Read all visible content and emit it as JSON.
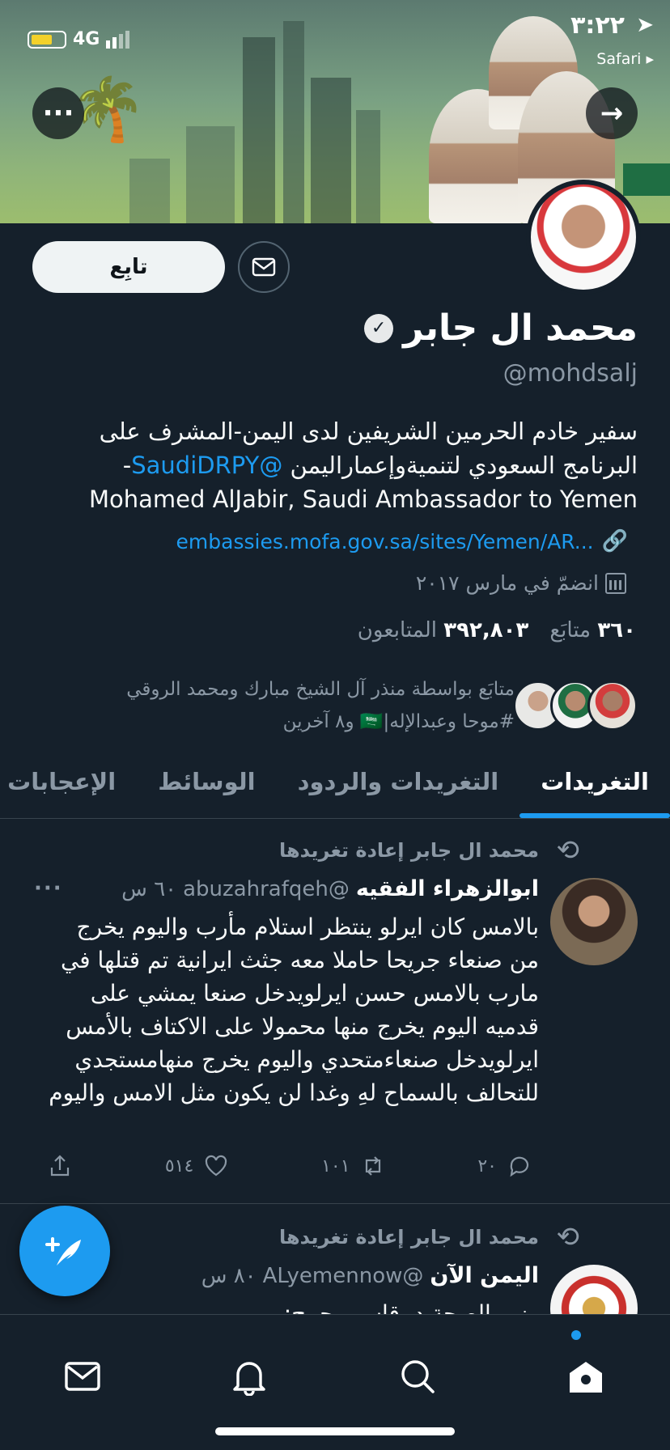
{
  "status_bar": {
    "time": "٣:٢٢",
    "back_app": "Safari ▸",
    "network": "4G"
  },
  "profile": {
    "name": "محمد ال جابر",
    "handle": "@mohdsalj",
    "follow_label": "تابِع",
    "bio_line1": "سفير خادم الحرمين الشريفين لدى اليمن-المشرف على",
    "bio_line2_prefix": "البرنامج السعودي لتنميةوإعماراليمن ",
    "bio_mention": "@SaudiDRPY",
    "bio_line2_suffix": "-",
    "bio_line3": "Mohamed AlJabir, Saudi Ambassador to Yemen",
    "website": "embassies.mofa.gov.sa/sites/Yemen/AR...",
    "joined": "انضمّ في مارس ٢٠١٧",
    "following_count": "٣٦٠",
    "following_label": "متابَع",
    "followers_count": "٣٩٢,٨٠٣",
    "followers_label": "المتابعون",
    "followed_by_line1": "متابَع بواسطة منذر آل الشيخ مبارك ومحمد الروقي",
    "followed_by_line2": "#موحا وعبدالإله|🇸🇦 و٨ آخرين"
  },
  "tabs": [
    {
      "label": "التغريدات",
      "active": true
    },
    {
      "label": "التغريدات والردود",
      "active": false
    },
    {
      "label": "الوسائط",
      "active": false
    },
    {
      "label": "الإعجابات",
      "active": false
    }
  ],
  "tweets": [
    {
      "retweet_label": "محمد ال جابر إعادة تغريدها",
      "author": "ابوالزهراء الفقيه",
      "handle": "@abuzahrafqeh",
      "time": "٦٠ س",
      "more": "···",
      "body": "بالامس كان ايرلو ينتظر استلام مأرب واليوم يخرج من صنعاء جريحا حاملا معه جثث ايرانية  تم قتلها في مارب بالامس حسن ايرلويدخل صنعا يمشي على قدميه اليوم يخرج منها محمولا على الاكتاف بالأمس ايرلويدخل صنعاءمتحدي واليوم يخرج منهامستجدي للتحالف بالسماح لهِ وغدا لن يكون مثل الامس واليوم",
      "replies": "٢٠",
      "retweets": "١٠١",
      "likes": "٥١٤"
    },
    {
      "retweet_label": "محمد ال جابر إعادة تغريدها",
      "author": "اليمن الآن",
      "handle": "@ALyemennow",
      "time": "٨٠ س",
      "body": "وزير الصحة د. قاسم بحيبح:"
    }
  ],
  "colors": {
    "background": "#15202b",
    "accent": "#1d9bf0",
    "secondary_text": "#8b98a5",
    "divider": "#38444d"
  },
  "icons": {
    "compose": "feather-plus-icon",
    "nav": [
      "mail-icon",
      "bell-icon",
      "search-icon",
      "home-icon"
    ]
  }
}
